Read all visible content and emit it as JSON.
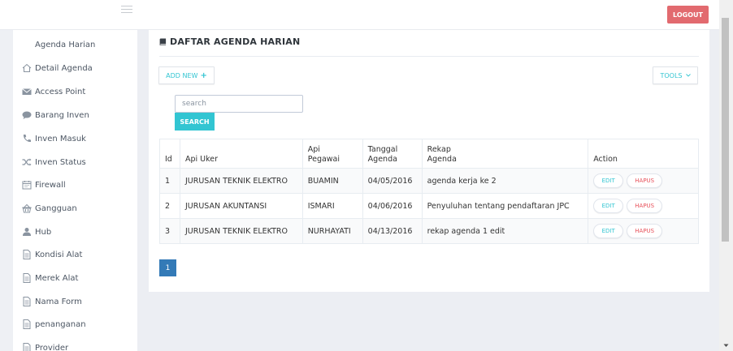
{
  "header": {
    "logout_label": "LOGOUT",
    "menu_icon": "hamburger-icon"
  },
  "sidebar": {
    "items": [
      {
        "label": "Agenda Harian",
        "icon": ""
      },
      {
        "label": "Detail Agenda",
        "icon": "home-icon"
      },
      {
        "label": "Access Point",
        "icon": "envelope-icon"
      },
      {
        "label": "Barang Inven",
        "icon": "comment-icon"
      },
      {
        "label": "Inven Masuk",
        "icon": "phone-icon"
      },
      {
        "label": "Inven Status",
        "icon": "shuffle-icon"
      },
      {
        "label": "Firewall",
        "icon": "calendar-icon"
      },
      {
        "label": "Gangguan",
        "icon": "basket-icon"
      },
      {
        "label": "Hub",
        "icon": "user-icon"
      },
      {
        "label": "Kondisi Alat",
        "icon": "document-icon"
      },
      {
        "label": "Merek Alat",
        "icon": "document-icon"
      },
      {
        "label": "Nama Form",
        "icon": "document-icon"
      },
      {
        "label": "penanganan",
        "icon": "document-icon"
      },
      {
        "label": "Provider",
        "icon": "document-icon"
      }
    ]
  },
  "main": {
    "title": "DAFTAR AGENDA HARIAN",
    "title_icon": "book-icon",
    "add_new_label": "ADD NEW",
    "tools_label": "TOOLS",
    "search": {
      "placeholder": "search",
      "value": "",
      "button_label": "SEARCH"
    },
    "table": {
      "headers": {
        "id": "Id",
        "uker": "Api Uker",
        "pegawai_1": "Api",
        "pegawai_2": "Pegawai",
        "tanggal_1": "Tanggal",
        "tanggal_2": "Agenda",
        "rekap_1": "Rekap",
        "rekap_2": "Agenda",
        "action": "Action"
      },
      "rows": [
        {
          "id": "1",
          "uker": "JURUSAN TEKNIK ELEKTRO",
          "pegawai": "BUAMIN",
          "tanggal": "04/05/2016",
          "rekap": "agenda kerja ke 2"
        },
        {
          "id": "2",
          "uker": "JURUSAN AKUNTANSI",
          "pegawai": "ISMARI",
          "tanggal": "04/06/2016",
          "rekap": "Penyuluhan tentang pendaftaran JPC"
        },
        {
          "id": "3",
          "uker": "JURUSAN TEKNIK ELEKTRO",
          "pegawai": "NURHAYATI",
          "tanggal": "04/13/2016",
          "rekap": "rekap agenda 1 edit"
        }
      ],
      "edit_label": "EDIT",
      "hapus_label": "HAPUS"
    },
    "pagination": {
      "current_page": "1"
    }
  },
  "colors": {
    "accent": "#32c5d2",
    "danger": "#e7505a",
    "logout": "#e26a6f",
    "pager": "#337ab7"
  }
}
